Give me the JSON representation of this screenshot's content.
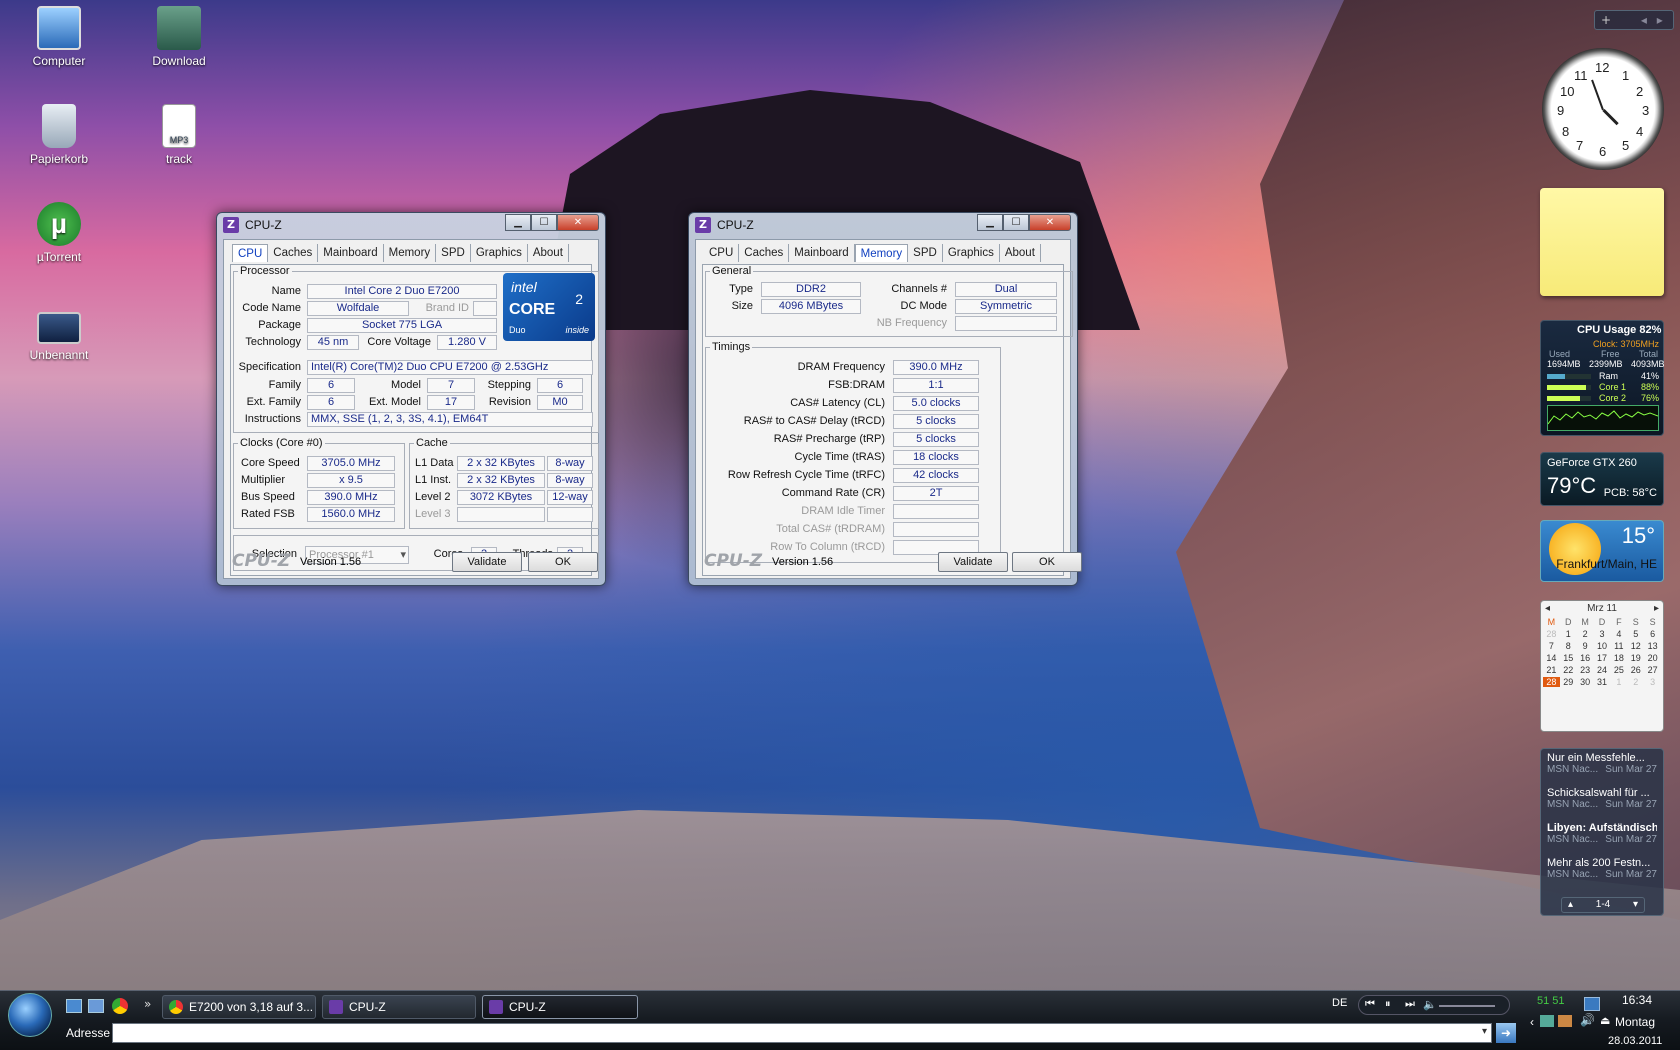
{
  "desktop_icons": [
    {
      "label": "Computer"
    },
    {
      "label": "Download"
    },
    {
      "label": "Papierkorb"
    },
    {
      "label": "track",
      "badge": "MP3"
    },
    {
      "label": "µTorrent"
    },
    {
      "label": "Unbenannt"
    }
  ],
  "cpuz_cpu": {
    "title": "CPU-Z",
    "tabs": [
      "CPU",
      "Caches",
      "Mainboard",
      "Memory",
      "SPD",
      "Graphics",
      "About"
    ],
    "active_tab": "CPU",
    "processor_legend": "Processor",
    "labels": {
      "name": "Name",
      "code_name": "Code Name",
      "brand_id": "Brand ID",
      "package": "Package",
      "technology": "Technology",
      "core_voltage": "Core Voltage",
      "specification": "Specification",
      "family": "Family",
      "model": "Model",
      "stepping": "Stepping",
      "ext_family": "Ext. Family",
      "ext_model": "Ext. Model",
      "revision": "Revision",
      "instructions": "Instructions"
    },
    "values": {
      "name": "Intel Core 2 Duo E7200",
      "code_name": "Wolfdale",
      "package": "Socket 775 LGA",
      "technology": "45 nm",
      "core_voltage": "1.280 V",
      "specification": "Intel(R) Core(TM)2 Duo CPU     E7200  @ 2.53GHz",
      "family": "6",
      "model": "7",
      "stepping": "6",
      "ext_family": "6",
      "ext_model": "17",
      "revision": "M0",
      "instructions": "MMX, SSE (1, 2, 3, 3S, 4.1), EM64T"
    },
    "logo": {
      "brand": "intel",
      "product": "CORE",
      "sub": "Duo",
      "tag": "inside",
      "superscript": "2"
    },
    "clocks_legend": "Clocks (Core #0)",
    "clocks": [
      {
        "label": "Core Speed",
        "value": "3705.0 MHz"
      },
      {
        "label": "Multiplier",
        "value": "x 9.5"
      },
      {
        "label": "Bus Speed",
        "value": "390.0 MHz"
      },
      {
        "label": "Rated FSB",
        "value": "1560.0 MHz"
      }
    ],
    "cache_legend": "Cache",
    "cache": [
      {
        "label": "L1 Data",
        "size": "2 x 32 KBytes",
        "ways": "8-way"
      },
      {
        "label": "L1 Inst.",
        "size": "2 x 32 KBytes",
        "ways": "8-way"
      },
      {
        "label": "Level 2",
        "size": "3072 KBytes",
        "ways": "12-way"
      },
      {
        "label": "Level 3",
        "size": "",
        "ways": ""
      }
    ],
    "selection_label": "Selection",
    "selection_value": "Processor #1",
    "cores_label": "Cores",
    "cores": "2",
    "threads_label": "Threads",
    "threads": "2",
    "brand": "CPU-Z",
    "version": "Version 1.56",
    "validate": "Validate",
    "ok": "OK"
  },
  "cpuz_mem": {
    "title": "CPU-Z",
    "tabs": [
      "CPU",
      "Caches",
      "Mainboard",
      "Memory",
      "SPD",
      "Graphics",
      "About"
    ],
    "active_tab": "Memory",
    "general_legend": "General",
    "general": {
      "type_label": "Type",
      "type": "DDR2",
      "size_label": "Size",
      "size": "4096 MBytes",
      "channels_label": "Channels #",
      "channels": "Dual",
      "dcmode_label": "DC Mode",
      "dcmode": "Symmetric",
      "nb_label": "NB Frequency",
      "nb": ""
    },
    "timings_legend": "Timings",
    "timings": [
      {
        "label": "DRAM Frequency",
        "value": "390.0 MHz"
      },
      {
        "label": "FSB:DRAM",
        "value": "1:1"
      },
      {
        "label": "CAS# Latency (CL)",
        "value": "5.0 clocks"
      },
      {
        "label": "RAS# to CAS# Delay (tRCD)",
        "value": "5 clocks"
      },
      {
        "label": "RAS# Precharge (tRP)",
        "value": "5 clocks"
      },
      {
        "label": "Cycle Time (tRAS)",
        "value": "18 clocks"
      },
      {
        "label": "Row Refresh Cycle Time (tRFC)",
        "value": "42 clocks"
      },
      {
        "label": "Command Rate (CR)",
        "value": "2T"
      },
      {
        "label": "DRAM Idle Timer",
        "value": ""
      },
      {
        "label": "Total CAS# (tRDRAM)",
        "value": ""
      },
      {
        "label": "Row To Column (tRCD)",
        "value": ""
      }
    ],
    "brand": "CPU-Z",
    "version": "Version 1.56",
    "validate": "Validate",
    "ok": "OK"
  },
  "gadgets": {
    "add_button": "+",
    "clock_numbers": [
      "12",
      "1",
      "2",
      "3",
      "4",
      "5",
      "6",
      "7",
      "8",
      "9",
      "10",
      "11"
    ],
    "cpu": {
      "title": "CPU Usage",
      "percent": "82%",
      "clock": "Clock: 3705MHz",
      "used_label": "Used",
      "free_label": "Free",
      "total_label": "Total",
      "used": "1694MB",
      "free": "2399MB",
      "total": "4093MB",
      "rows": [
        {
          "label": "Ram",
          "value": "41%",
          "level": 0.41
        },
        {
          "label": "Core 1",
          "value": "88%",
          "level": 0.88
        },
        {
          "label": "Core 2",
          "value": "76%",
          "level": 0.76
        }
      ]
    },
    "gpu": {
      "name": "GeForce GTX 260",
      "temp": "79°C",
      "pcb": "PCB: 58°C"
    },
    "weather": {
      "temp": "15°",
      "city": "Frankfurt/Main, HE"
    },
    "calendar": {
      "month": "Mrz 11",
      "weekdays": [
        "M",
        "D",
        "M",
        "D",
        "F",
        "S",
        "S"
      ],
      "weeks": [
        [
          "28",
          "1",
          "2",
          "3",
          "4",
          "5",
          "6"
        ],
        [
          "7",
          "8",
          "9",
          "10",
          "11",
          "12",
          "13"
        ],
        [
          "14",
          "15",
          "16",
          "17",
          "18",
          "19",
          "20"
        ],
        [
          "21",
          "22",
          "23",
          "24",
          "25",
          "26",
          "27"
        ],
        [
          "28",
          "29",
          "30",
          "31",
          "1",
          "2",
          "3"
        ]
      ]
    },
    "news": [
      {
        "title": "Nur ein Messfehle...",
        "source": "MSN Nac...",
        "date": "Sun Mar 27"
      },
      {
        "title": "Schicksalswahl für ...",
        "source": "MSN Nac...",
        "date": "Sun Mar 27"
      },
      {
        "title": "Libyen: Aufständisch...",
        "source": "MSN Nac...",
        "date": "Sun Mar 27"
      },
      {
        "title": "Mehr als 200 Festn...",
        "source": "MSN Nac...",
        "date": "Sun Mar 27"
      }
    ],
    "news_pager": "1-4"
  },
  "taskbar": {
    "tasks": [
      {
        "label": "E7200 von 3,18 auf 3..."
      },
      {
        "label": "CPU-Z"
      },
      {
        "label": "CPU-Z"
      }
    ],
    "address_label": "Adresse",
    "address_value": "",
    "lang": "DE",
    "time": "16:34",
    "day": "Montag",
    "date": "28.03.2011",
    "tray_nums": "51  51"
  }
}
